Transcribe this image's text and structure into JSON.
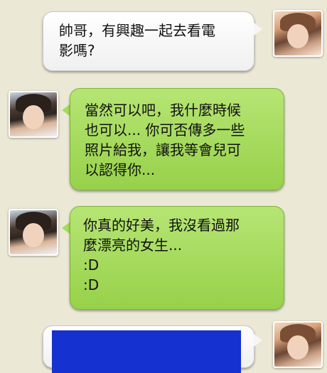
{
  "messages": [
    {
      "sender": "other",
      "lines": [
        "帥哥，有興趣一起去看電",
        "影嗎?"
      ]
    },
    {
      "sender": "me",
      "lines": [
        "當然可以吧，我什麼時候",
        "也可以... 你可否傳多一些",
        "照片給我，讓我等會兒可",
        "以認得你..."
      ]
    },
    {
      "sender": "me",
      "lines": [
        "你真的好美，我沒看過那",
        "麼漂亮的女生...",
        ":D",
        ":D"
      ]
    },
    {
      "sender": "other",
      "lines": []
    }
  ],
  "colors": {
    "background": "#ece8d6",
    "sent_bubble": "#a6dc5e",
    "received_bubble": "#ffffff",
    "image_placeholder": "#1531cf"
  }
}
